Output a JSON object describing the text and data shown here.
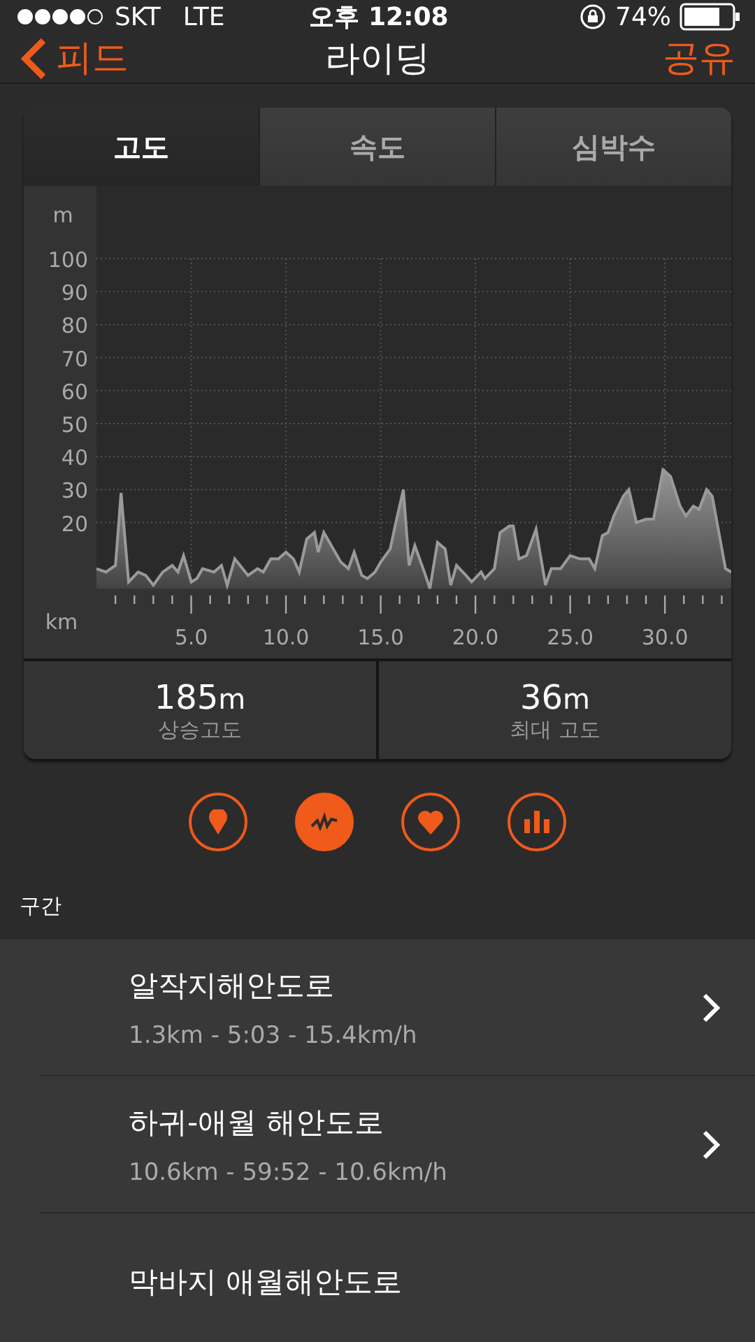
{
  "status_bar": {
    "carrier": "SKT",
    "network": "LTE",
    "time": "오후 12:08",
    "battery": "74%"
  },
  "nav": {
    "back": "피드",
    "title": "라이딩",
    "action": "공유"
  },
  "tabs": [
    {
      "label": "고도",
      "selected": true
    },
    {
      "label": "속도",
      "selected": false
    },
    {
      "label": "심박수",
      "selected": false
    }
  ],
  "chart_data": {
    "type": "area",
    "xlabel": "km",
    "ylabel": "m",
    "xlim": [
      0,
      33.5
    ],
    "ylim": [
      0,
      100
    ],
    "xticks": [
      {
        "value": 5,
        "label": "5.0"
      },
      {
        "value": 10,
        "label": "10.0"
      },
      {
        "value": 15,
        "label": "15.0"
      },
      {
        "value": 20,
        "label": "20.0"
      },
      {
        "value": 25,
        "label": "25.0"
      },
      {
        "value": 30,
        "label": "30.0"
      }
    ],
    "yticks": [
      20,
      30,
      40,
      50,
      60,
      70,
      80,
      90,
      100
    ],
    "x": [
      0,
      0.5,
      1,
      1.3,
      1.7,
      2.2,
      2.6,
      3,
      3.5,
      4,
      4.3,
      4.6,
      5,
      5.3,
      5.6,
      6.2,
      6.6,
      6.9,
      7.3,
      8,
      8.5,
      8.8,
      9.2,
      9.6,
      10,
      10.4,
      10.7,
      11.1,
      11.5,
      11.7,
      12,
      12.5,
      12.9,
      13.3,
      13.6,
      14,
      14.3,
      14.7,
      15,
      15.5,
      15.8,
      16.2,
      16.5,
      16.8,
      17.3,
      17.6,
      18,
      18.4,
      18.7,
      19,
      19.5,
      19.8,
      20.3,
      20.5,
      21,
      21.3,
      21.8,
      22,
      22.3,
      22.7,
      23.2,
      23.7,
      24,
      24.5,
      25,
      25.5,
      26,
      26.3,
      26.7,
      27,
      27.3,
      27.8,
      28.1,
      28.5,
      29,
      29.4,
      29.9,
      30.3,
      30.8,
      31.1,
      31.5,
      31.8,
      32.2,
      32.5,
      33.2,
      33.5
    ],
    "grid": true,
    "series": [
      {
        "color": "#9a9a9a",
        "values": [
          6,
          5,
          7,
          29,
          2,
          5,
          4,
          1,
          5,
          7,
          5,
          10,
          2,
          3,
          6,
          5,
          7,
          1,
          9,
          4,
          6,
          5,
          9,
          9,
          11,
          9,
          5,
          15,
          17,
          11,
          17,
          12,
          8,
          6,
          11,
          4,
          3,
          5,
          8,
          12,
          20,
          30,
          7,
          13,
          5,
          0,
          14,
          12,
          1,
          7,
          4,
          2,
          5,
          3,
          6,
          17,
          19,
          19,
          9,
          10,
          18,
          1,
          6,
          6,
          10,
          9,
          9,
          6,
          16,
          17,
          22,
          28,
          30,
          20,
          21,
          21,
          36,
          34,
          25,
          22,
          25,
          24,
          30,
          28,
          6,
          5
        ]
      }
    ]
  },
  "stats": [
    {
      "value": "185",
      "unit": "m",
      "label": "상승고도"
    },
    {
      "value": "36",
      "unit": "m",
      "label": "최대 고도"
    }
  ],
  "view_buttons": [
    {
      "kind": "pin",
      "selected": false
    },
    {
      "kind": "wave",
      "selected": true
    },
    {
      "kind": "heart",
      "selected": false
    },
    {
      "kind": "bars",
      "selected": false
    }
  ],
  "section_title": "구간",
  "segments": [
    {
      "name": "알작지해안도로",
      "detail": "1.3km - 5:03 - 15.4km/h"
    },
    {
      "name": "하귀-애월 해안도로",
      "detail": "10.6km - 59:52 - 10.6km/h"
    },
    {
      "name": "막바지 애월해안도로"
    }
  ]
}
